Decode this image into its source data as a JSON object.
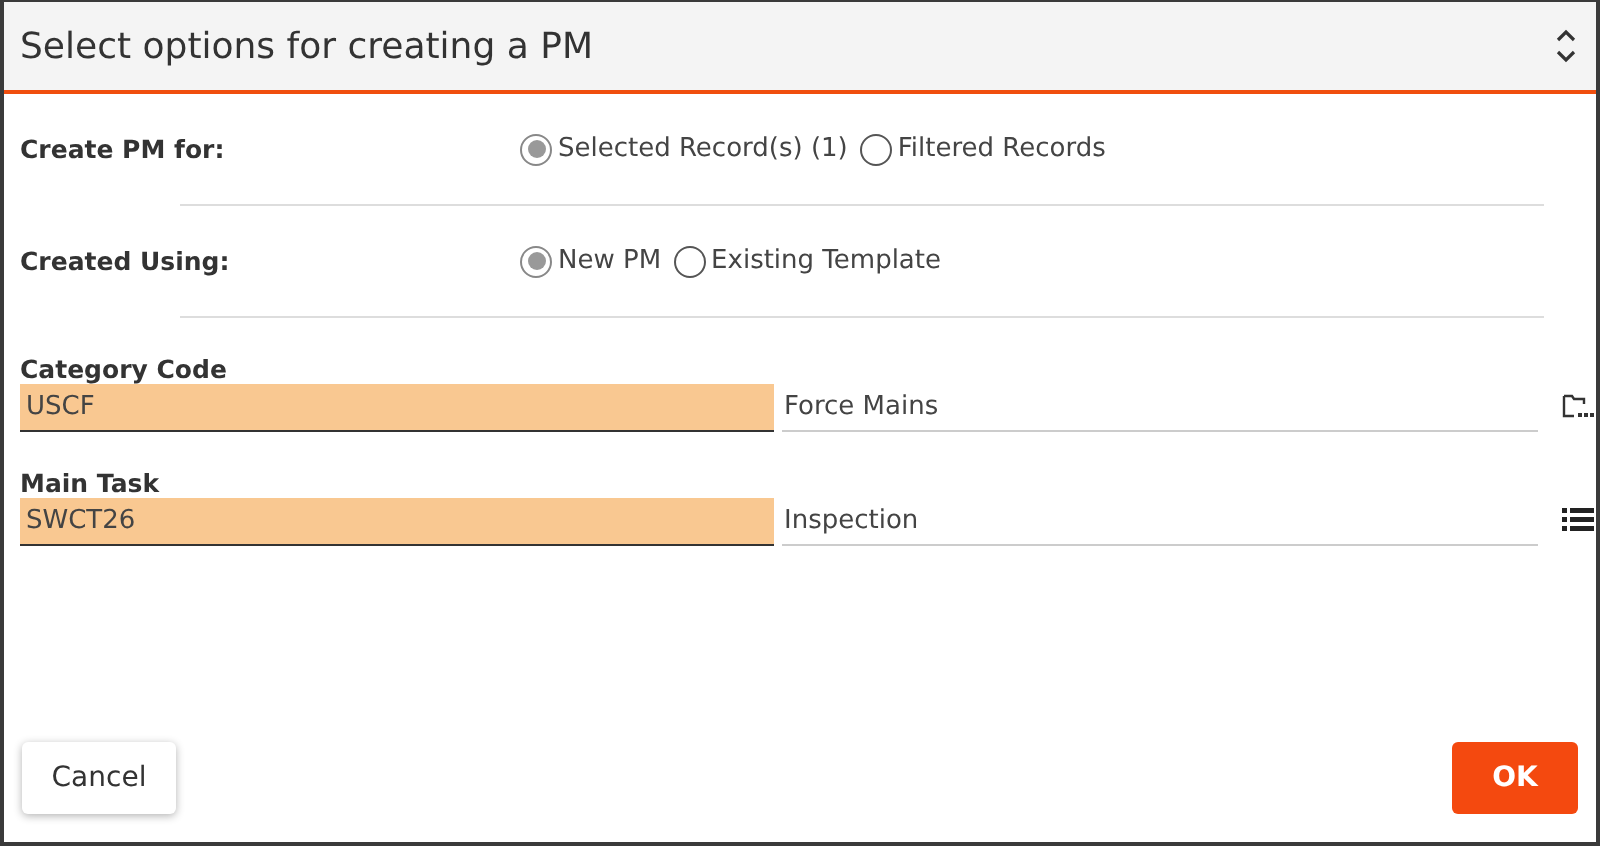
{
  "window": {
    "title": "Select options for creating a PM"
  },
  "option_groups": [
    {
      "label": "Create PM for:",
      "options": [
        {
          "label": "Selected Record(s) (1)",
          "selected": true
        },
        {
          "label": "Filtered Records",
          "selected": false
        }
      ]
    },
    {
      "label": "Created Using:",
      "options": [
        {
          "label": "New PM",
          "selected": true
        },
        {
          "label": "Existing Template",
          "selected": false
        }
      ]
    }
  ],
  "fields": [
    {
      "label": "Category Code",
      "value": "USCF",
      "description": "Force Mains",
      "kind": "browse"
    },
    {
      "label": "Main Task",
      "value": "SWCT26",
      "description": "Inspection",
      "kind": "list"
    }
  ],
  "buttons": [
    {
      "label": "Cancel",
      "kind": "secondary"
    },
    {
      "label": "OK",
      "kind": "primary"
    }
  ]
}
